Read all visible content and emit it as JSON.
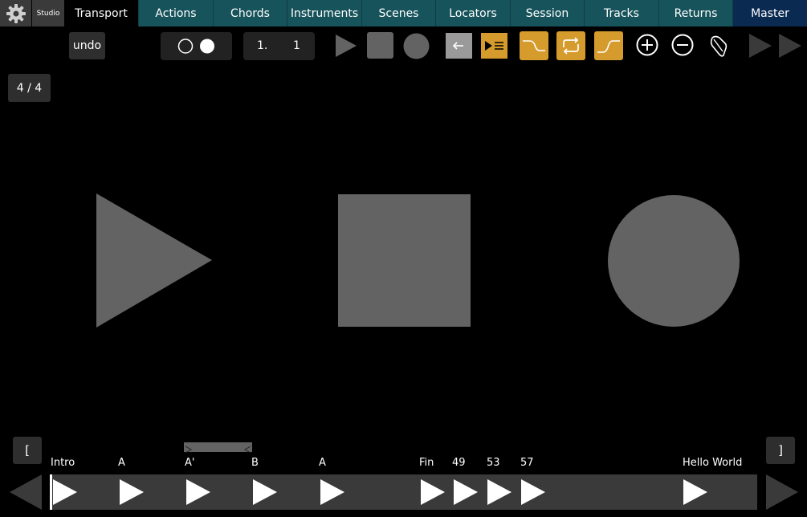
{
  "nav": {
    "studio_label": "Studio",
    "tabs": [
      "Transport",
      "Actions",
      "Chords",
      "Instruments",
      "Scenes",
      "Locators",
      "Session",
      "Tracks",
      "Returns",
      "Master"
    ],
    "active_tab": "Transport"
  },
  "toolbar": {
    "undo_label": "undo",
    "position_bar": "1.",
    "position_beat": "1",
    "time_signature": "4 / 4"
  },
  "colors": {
    "accent": "#d59b2d",
    "tab_teal": "#17535b",
    "tab_navy": "#0a2a52",
    "shape_gray": "#636363"
  },
  "locators": {
    "start_bracket": "[",
    "end_bracket": "]",
    "items": [
      "Intro",
      "A",
      "A'",
      "B",
      "A",
      "Fin",
      "49",
      "53",
      "57",
      "Hello World"
    ]
  }
}
